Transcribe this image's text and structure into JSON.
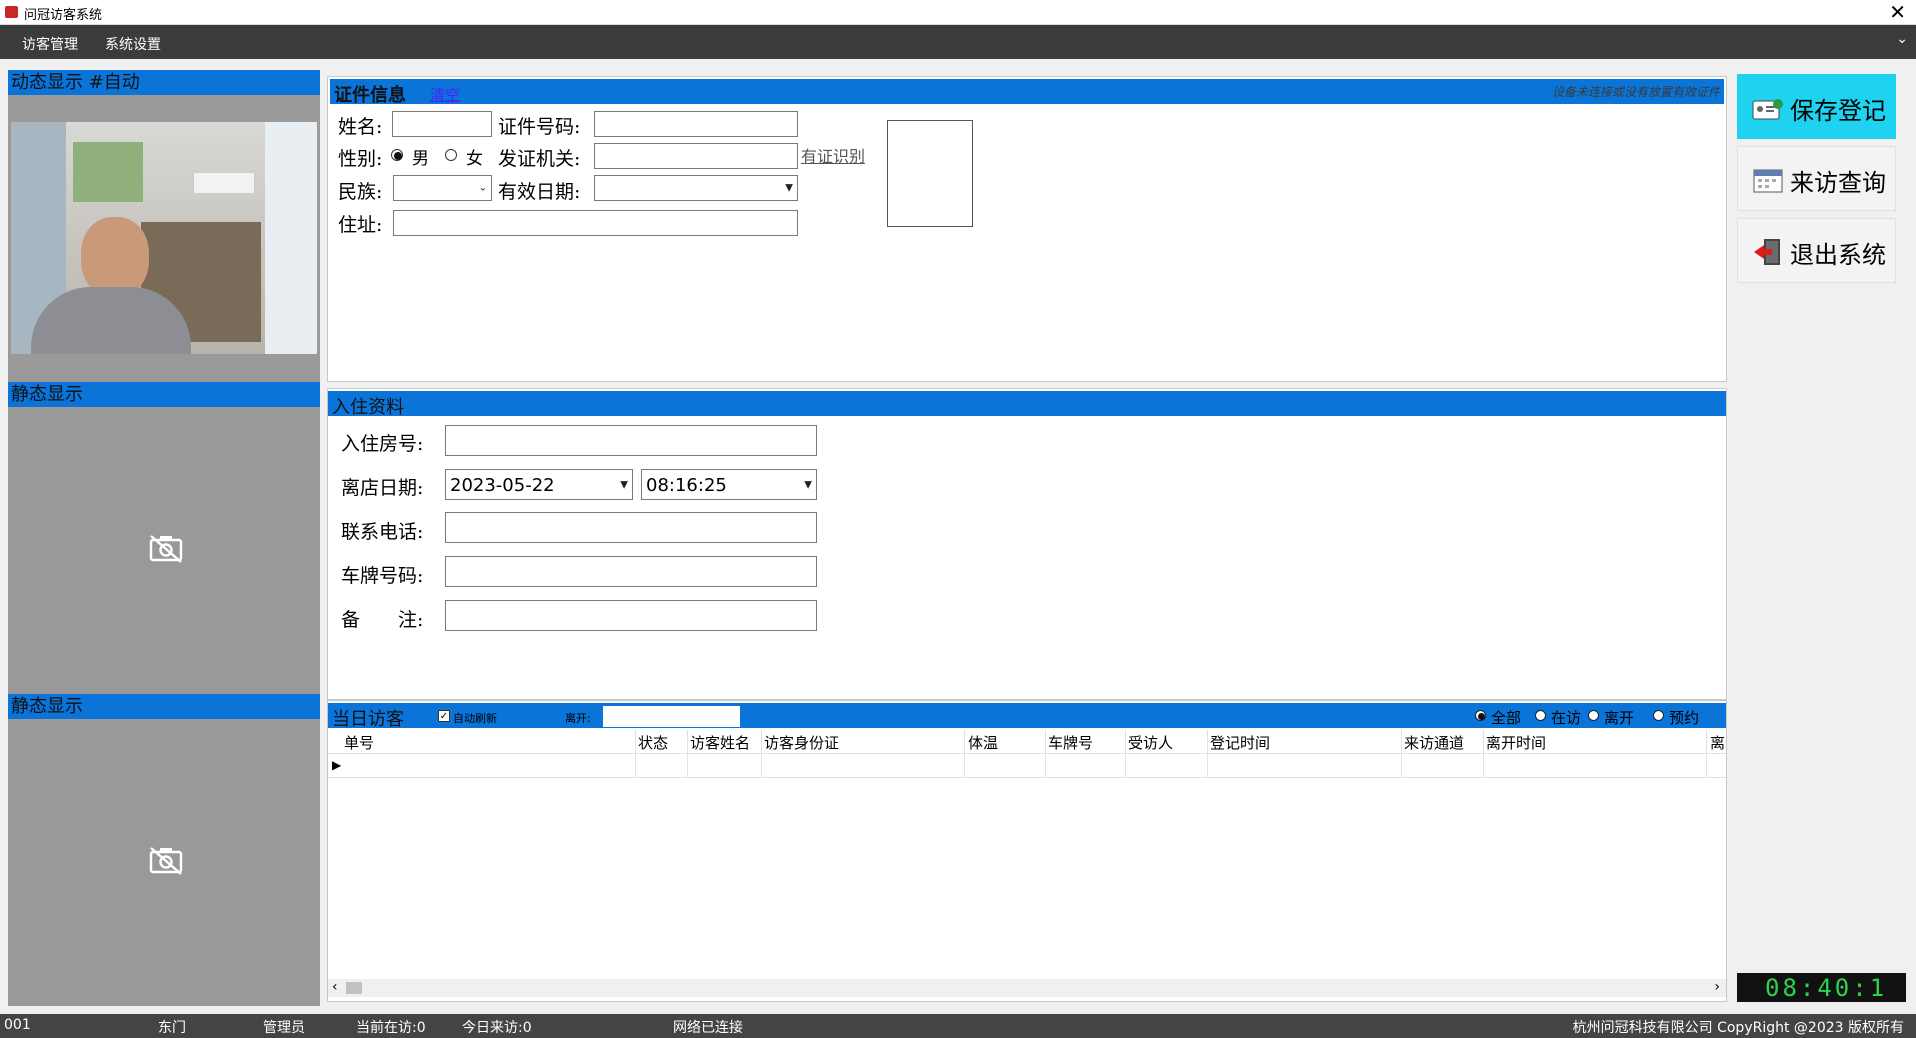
{
  "window": {
    "title": "问冠访客系统"
  },
  "menu": {
    "items": [
      "访客管理",
      "系统设置"
    ]
  },
  "left_panels": {
    "dynamic_title": "动态显示 #自动",
    "static_title_1": "静态显示",
    "static_title_2": "静态显示"
  },
  "cert": {
    "title": "证件信息",
    "clear_link": "清空",
    "warning": "设备未连接或没有放置有效证件",
    "name_label": "姓名:",
    "id_label": "证件号码:",
    "gender_label": "性别:",
    "male": "男",
    "female": "女",
    "issuer_label": "发证机关:",
    "recognize_link": "有证识别",
    "ethnicity_label": "民族:",
    "valid_label": "有效日期:",
    "address_label": "住址:"
  },
  "checkin": {
    "title": "入住资料",
    "room_label": "入住房号:",
    "leave_date_label": "离店日期:",
    "leave_date": "2023-05-22",
    "leave_time": "08:16:25",
    "phone_label": "联系电话:",
    "plate_label": "车牌号码:",
    "remark_label": "备　　注:"
  },
  "today": {
    "title": "当日访客",
    "auto_refresh": "自动刷新",
    "leave_label": "离开:",
    "filters": [
      "全部",
      "在访",
      "离开",
      "预约"
    ],
    "columns": [
      "单号",
      "状态",
      "访客姓名",
      "访客身份证",
      "体温",
      "车牌号",
      "受访人",
      "登记时间",
      "来访通道",
      "离开时间",
      "离"
    ]
  },
  "actions": {
    "save": "保存登记",
    "query": "来访查询",
    "exit": "退出系统"
  },
  "clock": "08:40:1",
  "status": {
    "code": "001",
    "gate": "东门",
    "role": "管理员",
    "current": "当前在访:0",
    "today": "今日来访:0",
    "network": "网络已连接",
    "copyright": "杭州问冠科技有限公司 CopyRight @2023  版权所有"
  },
  "colors": {
    "header_blue": "#0a74d8",
    "save_cyan": "#1ed3f0",
    "clock_green": "#2bd34f"
  }
}
